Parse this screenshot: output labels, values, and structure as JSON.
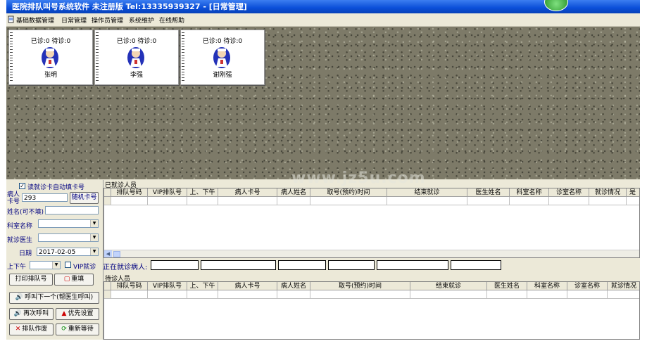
{
  "window": {
    "title": "医院排队叫号系统软件  未注册版  Tel:13335939327  -  [日常管理]"
  },
  "menu": [
    "基础数据管理",
    "日常管理",
    "操作员管理",
    "系统维护",
    "在线帮助"
  ],
  "doctors": [
    {
      "stats": "已诊:0  待诊:0",
      "name": "张明"
    },
    {
      "stats": "已诊:0  待诊:0",
      "name": "李强"
    },
    {
      "stats": "已诊:0  待诊:0",
      "name": "谢刚强"
    }
  ],
  "watermark": "www.jz5u.com",
  "form": {
    "auto_card_label": "读就诊卡自动填卡号",
    "card_label": "病人卡号",
    "card_value": "293",
    "random_card_button": "随机卡号",
    "name_label": "姓名(可不填)",
    "name_value": "",
    "dept_label": "科室名称",
    "dept_value": "",
    "doctor_label": "就诊医生",
    "doctor_value": "",
    "date_label": "日期",
    "date_value": "2017-02-05",
    "ampm_label": "上下午",
    "ampm_value": "",
    "vip_label": "VIP就诊",
    "print_button": "打印排队号",
    "reset_button": "重填",
    "call_next_button": "呼叫下一个(帮医生呼叫)",
    "recall_button": "再次呼叫",
    "priority_button": "优先设置",
    "cancel_button": "排队作废",
    "requeue_button": "重新等待"
  },
  "treated": {
    "title": "已就诊人员",
    "columns": [
      "排队号码",
      "VIP排队号",
      "上、下午",
      "病人卡号",
      "病人姓名",
      "取号(预约)时间",
      "结束就诊",
      "医生姓名",
      "科室名称",
      "诊室名称",
      "就诊情况",
      "是"
    ]
  },
  "current": {
    "label": "正在就诊病人:"
  },
  "waiting": {
    "title": "待诊人员",
    "columns": [
      "排队号码",
      "VIP排队号",
      "上、下午",
      "病人卡号",
      "病人姓名",
      "取号(预约)时间",
      "结束就诊",
      "医生姓名",
      "科室名称",
      "诊室名称",
      "就诊情况"
    ]
  },
  "colors": {
    "title_bar": "#0a4ed8",
    "label_text": "#000080",
    "window_bg": "#ece9d8"
  }
}
